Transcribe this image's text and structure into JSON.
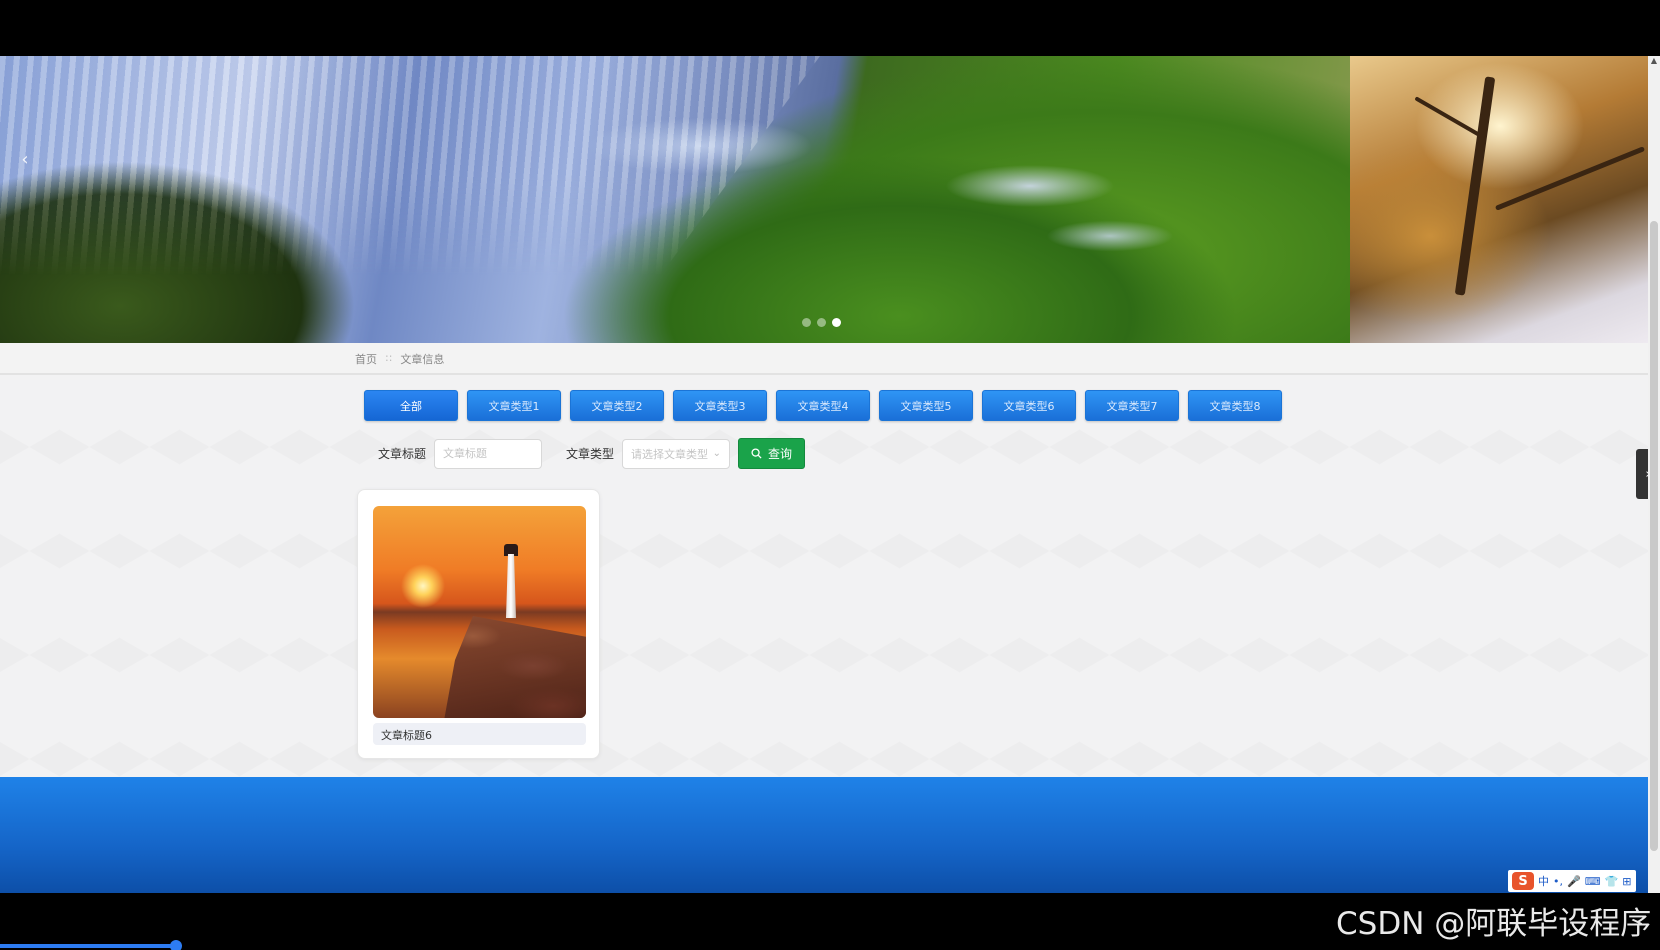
{
  "banner": {
    "prev_arrow": "‹",
    "slides": 3,
    "active_slide": 3
  },
  "breadcrumb": {
    "home": "首页",
    "separator": "::",
    "current": "文章信息"
  },
  "categories": [
    {
      "label": "全部",
      "active": true
    },
    {
      "label": "文章类型1"
    },
    {
      "label": "文章类型2"
    },
    {
      "label": "文章类型3"
    },
    {
      "label": "文章类型4"
    },
    {
      "label": "文章类型5"
    },
    {
      "label": "文章类型6"
    },
    {
      "label": "文章类型7"
    },
    {
      "label": "文章类型8"
    }
  ],
  "search": {
    "title_label": "文章标题",
    "title_placeholder": "文章标题",
    "type_label": "文章类型",
    "type_placeholder": "请选择文章类型",
    "query_label": "查询"
  },
  "articles": [
    {
      "title": "文章标题6"
    }
  ],
  "side_tab": "›",
  "ime": {
    "logo": "S",
    "mode": "中"
  },
  "watermark": "CSDN @阿联毕设程序",
  "colors": {
    "primary": "#1a6fd8",
    "query": "#1aa34a",
    "footer": "#1565c8"
  }
}
